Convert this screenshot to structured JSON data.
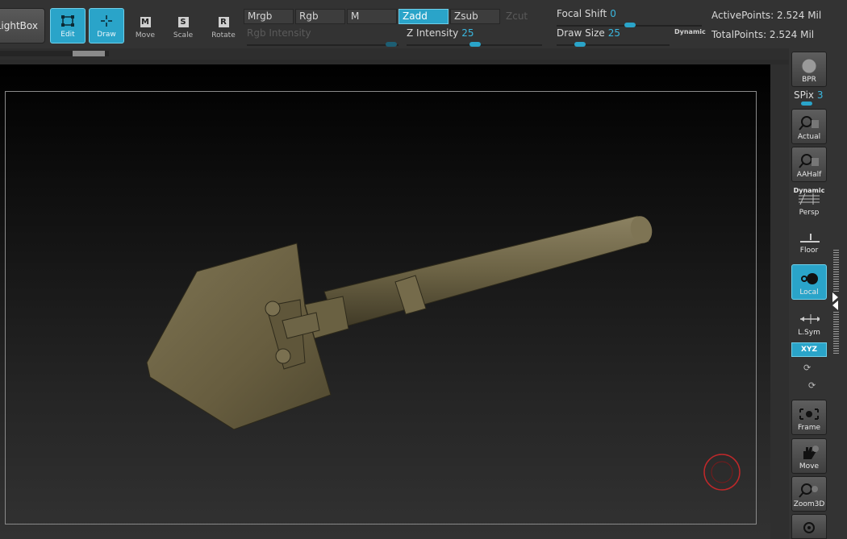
{
  "toolbar": {
    "lightbox_label": "LightBox",
    "edit_label": "Edit",
    "draw_label": "Draw",
    "move_label": "Move",
    "move_key": "M",
    "scale_label": "Scale",
    "scale_key": "S",
    "rotate_label": "Rotate",
    "rotate_key": "R",
    "mrgb_label": "Mrgb",
    "rgb_label": "Rgb",
    "m_label": "M",
    "zadd_label": "Zadd",
    "zsub_label": "Zsub",
    "zcut_label": "Zcut",
    "rgb_intensity_label": "Rgb Intensity",
    "z_intensity_label": "Z Intensity",
    "z_intensity_value": "25",
    "focal_shift_label": "Focal Shift",
    "focal_shift_value": "0",
    "draw_size_label": "Draw Size",
    "draw_size_value": "25",
    "dynamic_label": "Dynamic",
    "active_points": "ActivePoints: 2.524 Mil",
    "total_points": "TotalPoints: 2.524 Mil"
  },
  "right_shelf": {
    "bpr_label": "BPR",
    "spix_label": "SPix",
    "spix_value": "3",
    "actual_label": "Actual",
    "aahalf_label": "AAHalf",
    "persp_label": "Persp",
    "persp_dynamic_label": "Dynamic",
    "floor_label": "Floor",
    "local_label": "Local",
    "lsym_label": "L.Sym",
    "xyz_label": "XYZ",
    "frame_label": "Frame",
    "move_label": "Move",
    "zoom3d_label": "Zoom3D"
  },
  "colors": {
    "accent": "#2aa4c9",
    "model": "#6e6446",
    "cursor": "#c0282a"
  }
}
